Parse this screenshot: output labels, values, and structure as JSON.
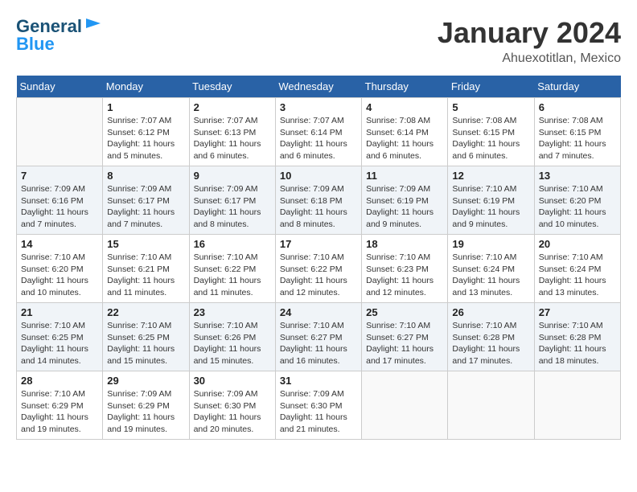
{
  "header": {
    "logo_line1": "General",
    "logo_line2": "Blue",
    "month_title": "January 2024",
    "location": "Ahuexotitlan, Mexico"
  },
  "weekdays": [
    "Sunday",
    "Monday",
    "Tuesday",
    "Wednesday",
    "Thursday",
    "Friday",
    "Saturday"
  ],
  "weeks": [
    [
      {
        "day": "",
        "sunrise": "",
        "sunset": "",
        "daylight": ""
      },
      {
        "day": "1",
        "sunrise": "Sunrise: 7:07 AM",
        "sunset": "Sunset: 6:12 PM",
        "daylight": "Daylight: 11 hours and 5 minutes."
      },
      {
        "day": "2",
        "sunrise": "Sunrise: 7:07 AM",
        "sunset": "Sunset: 6:13 PM",
        "daylight": "Daylight: 11 hours and 6 minutes."
      },
      {
        "day": "3",
        "sunrise": "Sunrise: 7:07 AM",
        "sunset": "Sunset: 6:14 PM",
        "daylight": "Daylight: 11 hours and 6 minutes."
      },
      {
        "day": "4",
        "sunrise": "Sunrise: 7:08 AM",
        "sunset": "Sunset: 6:14 PM",
        "daylight": "Daylight: 11 hours and 6 minutes."
      },
      {
        "day": "5",
        "sunrise": "Sunrise: 7:08 AM",
        "sunset": "Sunset: 6:15 PM",
        "daylight": "Daylight: 11 hours and 6 minutes."
      },
      {
        "day": "6",
        "sunrise": "Sunrise: 7:08 AM",
        "sunset": "Sunset: 6:15 PM",
        "daylight": "Daylight: 11 hours and 7 minutes."
      }
    ],
    [
      {
        "day": "7",
        "sunrise": "Sunrise: 7:09 AM",
        "sunset": "Sunset: 6:16 PM",
        "daylight": "Daylight: 11 hours and 7 minutes."
      },
      {
        "day": "8",
        "sunrise": "Sunrise: 7:09 AM",
        "sunset": "Sunset: 6:17 PM",
        "daylight": "Daylight: 11 hours and 7 minutes."
      },
      {
        "day": "9",
        "sunrise": "Sunrise: 7:09 AM",
        "sunset": "Sunset: 6:17 PM",
        "daylight": "Daylight: 11 hours and 8 minutes."
      },
      {
        "day": "10",
        "sunrise": "Sunrise: 7:09 AM",
        "sunset": "Sunset: 6:18 PM",
        "daylight": "Daylight: 11 hours and 8 minutes."
      },
      {
        "day": "11",
        "sunrise": "Sunrise: 7:09 AM",
        "sunset": "Sunset: 6:19 PM",
        "daylight": "Daylight: 11 hours and 9 minutes."
      },
      {
        "day": "12",
        "sunrise": "Sunrise: 7:10 AM",
        "sunset": "Sunset: 6:19 PM",
        "daylight": "Daylight: 11 hours and 9 minutes."
      },
      {
        "day": "13",
        "sunrise": "Sunrise: 7:10 AM",
        "sunset": "Sunset: 6:20 PM",
        "daylight": "Daylight: 11 hours and 10 minutes."
      }
    ],
    [
      {
        "day": "14",
        "sunrise": "Sunrise: 7:10 AM",
        "sunset": "Sunset: 6:20 PM",
        "daylight": "Daylight: 11 hours and 10 minutes."
      },
      {
        "day": "15",
        "sunrise": "Sunrise: 7:10 AM",
        "sunset": "Sunset: 6:21 PM",
        "daylight": "Daylight: 11 hours and 11 minutes."
      },
      {
        "day": "16",
        "sunrise": "Sunrise: 7:10 AM",
        "sunset": "Sunset: 6:22 PM",
        "daylight": "Daylight: 11 hours and 11 minutes."
      },
      {
        "day": "17",
        "sunrise": "Sunrise: 7:10 AM",
        "sunset": "Sunset: 6:22 PM",
        "daylight": "Daylight: 11 hours and 12 minutes."
      },
      {
        "day": "18",
        "sunrise": "Sunrise: 7:10 AM",
        "sunset": "Sunset: 6:23 PM",
        "daylight": "Daylight: 11 hours and 12 minutes."
      },
      {
        "day": "19",
        "sunrise": "Sunrise: 7:10 AM",
        "sunset": "Sunset: 6:24 PM",
        "daylight": "Daylight: 11 hours and 13 minutes."
      },
      {
        "day": "20",
        "sunrise": "Sunrise: 7:10 AM",
        "sunset": "Sunset: 6:24 PM",
        "daylight": "Daylight: 11 hours and 13 minutes."
      }
    ],
    [
      {
        "day": "21",
        "sunrise": "Sunrise: 7:10 AM",
        "sunset": "Sunset: 6:25 PM",
        "daylight": "Daylight: 11 hours and 14 minutes."
      },
      {
        "day": "22",
        "sunrise": "Sunrise: 7:10 AM",
        "sunset": "Sunset: 6:25 PM",
        "daylight": "Daylight: 11 hours and 15 minutes."
      },
      {
        "day": "23",
        "sunrise": "Sunrise: 7:10 AM",
        "sunset": "Sunset: 6:26 PM",
        "daylight": "Daylight: 11 hours and 15 minutes."
      },
      {
        "day": "24",
        "sunrise": "Sunrise: 7:10 AM",
        "sunset": "Sunset: 6:27 PM",
        "daylight": "Daylight: 11 hours and 16 minutes."
      },
      {
        "day": "25",
        "sunrise": "Sunrise: 7:10 AM",
        "sunset": "Sunset: 6:27 PM",
        "daylight": "Daylight: 11 hours and 17 minutes."
      },
      {
        "day": "26",
        "sunrise": "Sunrise: 7:10 AM",
        "sunset": "Sunset: 6:28 PM",
        "daylight": "Daylight: 11 hours and 17 minutes."
      },
      {
        "day": "27",
        "sunrise": "Sunrise: 7:10 AM",
        "sunset": "Sunset: 6:28 PM",
        "daylight": "Daylight: 11 hours and 18 minutes."
      }
    ],
    [
      {
        "day": "28",
        "sunrise": "Sunrise: 7:10 AM",
        "sunset": "Sunset: 6:29 PM",
        "daylight": "Daylight: 11 hours and 19 minutes."
      },
      {
        "day": "29",
        "sunrise": "Sunrise: 7:09 AM",
        "sunset": "Sunset: 6:29 PM",
        "daylight": "Daylight: 11 hours and 19 minutes."
      },
      {
        "day": "30",
        "sunrise": "Sunrise: 7:09 AM",
        "sunset": "Sunset: 6:30 PM",
        "daylight": "Daylight: 11 hours and 20 minutes."
      },
      {
        "day": "31",
        "sunrise": "Sunrise: 7:09 AM",
        "sunset": "Sunset: 6:30 PM",
        "daylight": "Daylight: 11 hours and 21 minutes."
      },
      {
        "day": "",
        "sunrise": "",
        "sunset": "",
        "daylight": ""
      },
      {
        "day": "",
        "sunrise": "",
        "sunset": "",
        "daylight": ""
      },
      {
        "day": "",
        "sunrise": "",
        "sunset": "",
        "daylight": ""
      }
    ]
  ]
}
